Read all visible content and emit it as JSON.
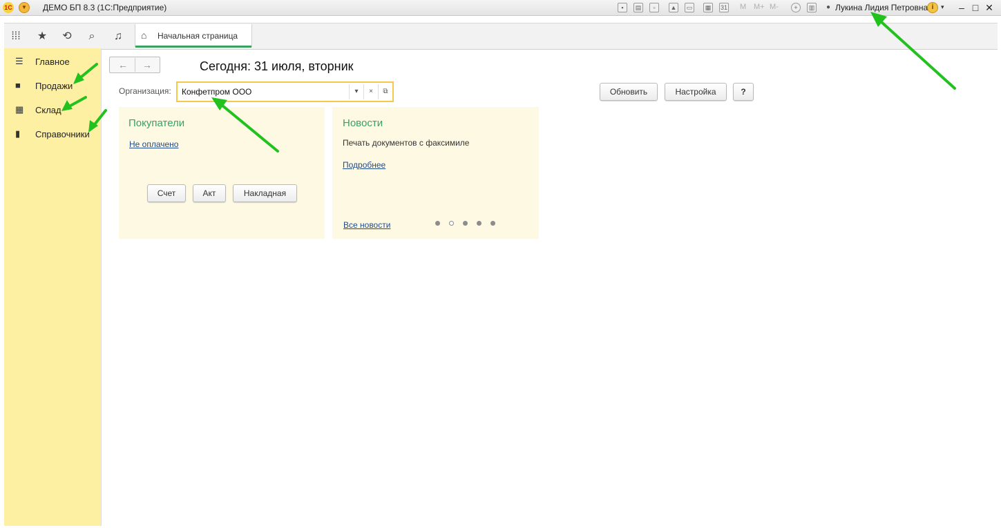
{
  "titlebar": {
    "logo": "1С",
    "title": "ДЕМО БП 8.3  (1С:Предприятие)",
    "memory_buttons": [
      "M",
      "M+",
      "M-"
    ],
    "user": "Лукина Лидия Петровна",
    "icons": [
      "save-icon",
      "print-icon",
      "preview-icon",
      "upload-icon",
      "scan-icon",
      "calculator-icon",
      "calendar-icon",
      "zoom-icon",
      "panels-icon"
    ]
  },
  "toolbar": {
    "tools": [
      "apps-icon",
      "star-icon",
      "history-icon",
      "search-icon",
      "bell-icon"
    ],
    "home_tab": "Начальная страница"
  },
  "sidebar": {
    "items": [
      {
        "label": "Главное",
        "icon": "menu-lines-icon"
      },
      {
        "label": "Продажи",
        "icon": "bag-icon"
      },
      {
        "label": "Склад",
        "icon": "warehouse-icon"
      },
      {
        "label": "Справочники",
        "icon": "books-icon"
      }
    ]
  },
  "main": {
    "today": "Сегодня: 31 июля, вторник",
    "org_label": "Организация:",
    "org_value": "Конфетпром ООО",
    "buttons": {
      "refresh": "Обновить",
      "settings": "Настройка",
      "help": "?"
    },
    "customers": {
      "title": "Покупатели",
      "link": "Не оплачено",
      "buttons": [
        "Счет",
        "Акт",
        "Накладная"
      ]
    },
    "news": {
      "title": "Новости",
      "text": "Печать документов с факсимиле",
      "more": "Подробнее",
      "all": "Все новости",
      "dots_total": 5,
      "dots_active_index": 1
    }
  },
  "colors": {
    "sidebar_bg": "#fdf0a3",
    "accent_green": "#3aa163",
    "panel_bg": "#fdf9e3",
    "field_border": "#f4c94a",
    "annotation_arrow": "#22c21e"
  }
}
